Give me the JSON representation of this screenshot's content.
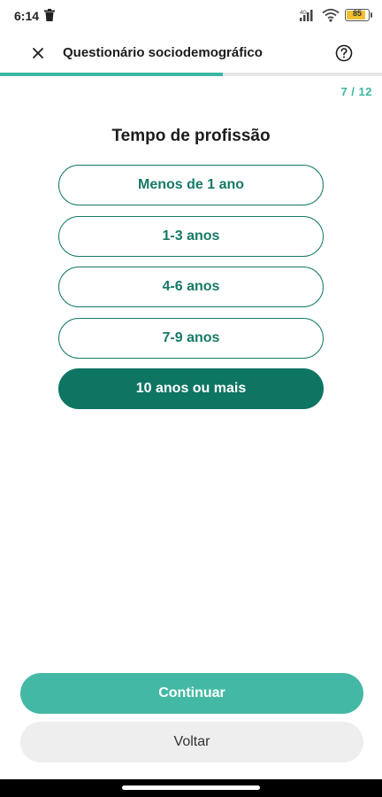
{
  "status_bar": {
    "time": "6:14",
    "battery_level": "85",
    "icons": [
      "trash-icon",
      "signal-icon",
      "wifi-icon",
      "battery-icon"
    ]
  },
  "header": {
    "title": "Questionário sociodemográfico",
    "close_icon": "close-icon",
    "help_icon": "help-icon"
  },
  "progress": {
    "current": 7,
    "total": 12,
    "label": "7 / 12",
    "fraction": 0.583
  },
  "question": {
    "title": "Tempo de profissão",
    "options": [
      {
        "label": "Menos de 1 ano",
        "selected": false
      },
      {
        "label": "1-3 anos",
        "selected": false
      },
      {
        "label": "4-6 anos",
        "selected": false
      },
      {
        "label": "7-9 anos",
        "selected": false
      },
      {
        "label": "10 anos ou mais",
        "selected": true
      }
    ]
  },
  "actions": {
    "continue_label": "Continuar",
    "back_label": "Voltar"
  },
  "colors": {
    "accent": "#3ab7a1",
    "primary_dark": "#0e7563",
    "continue_bg": "#43b9a5",
    "back_bg": "#eeeeee"
  }
}
